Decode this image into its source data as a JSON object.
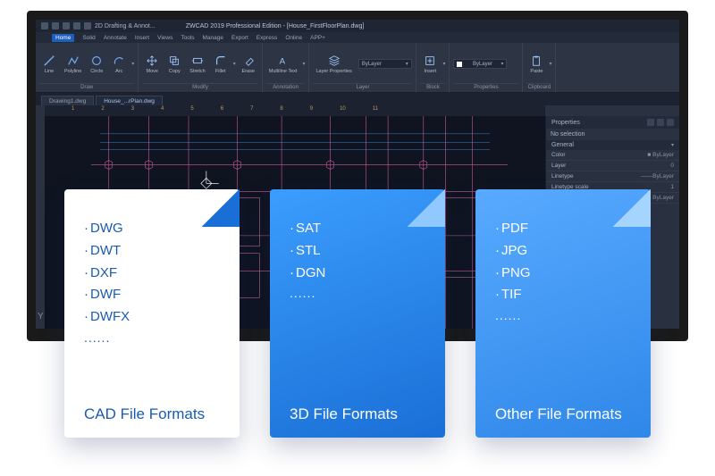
{
  "window": {
    "workspace": "2D Drafting & Annot...",
    "title": "ZWCAD 2019 Professional Edition - [House_FirstFloorPlan.dwg]"
  },
  "menu": [
    "Home",
    "Solid",
    "Annotate",
    "Insert",
    "Views",
    "Tools",
    "Manage",
    "Export",
    "Express",
    "Online",
    "APP+"
  ],
  "ribbon": {
    "draw": {
      "label": "Draw",
      "items": [
        "Line",
        "Polyline",
        "Circle",
        "Arc"
      ]
    },
    "modify": {
      "label": "Modify",
      "items": [
        "Move",
        "Copy",
        "Stretch",
        "Fillet",
        "Erase"
      ]
    },
    "annotation": {
      "label": "Annotation",
      "items": [
        "Multiline Text"
      ]
    },
    "layer": {
      "label": "Layer",
      "props_btn": "Layer Properties",
      "selected": "ByLayer"
    },
    "block": {
      "label": "Block",
      "items": [
        "Insert"
      ]
    },
    "properties": {
      "label": "Properties",
      "selected": "ByLayer"
    },
    "clipboard": {
      "label": "Clipboard",
      "items": [
        "Paste"
      ]
    }
  },
  "tabs": [
    "Drawing1.dwg",
    "House_...rPlan.dwg"
  ],
  "ruler_h": [
    "1",
    "2",
    "3",
    "4",
    "5",
    "6",
    "7",
    "8",
    "9",
    "10",
    "11"
  ],
  "properties_panel": {
    "title": "Properties",
    "selection": "No selection",
    "section": "General",
    "rows": [
      {
        "k": "Color",
        "v": "■ ByLayer"
      },
      {
        "k": "Layer",
        "v": "0"
      },
      {
        "k": "Linetype",
        "v": "——ByLayer"
      },
      {
        "k": "Linetype scale",
        "v": "1"
      },
      {
        "k": "",
        "v": "— ByLayer"
      }
    ]
  },
  "axis_y": "Y",
  "cards": [
    {
      "title": "CAD File Formats",
      "items": [
        "DWG",
        "DWT",
        "DXF",
        "DWF",
        "DWFX"
      ],
      "more": "......"
    },
    {
      "title": "3D File Formats",
      "items": [
        "SAT",
        "STL",
        "DGN"
      ],
      "more": "......"
    },
    {
      "title": "Other File Formats",
      "items": [
        "PDF",
        "JPG",
        "PNG",
        "TIF"
      ],
      "more": "......"
    }
  ]
}
